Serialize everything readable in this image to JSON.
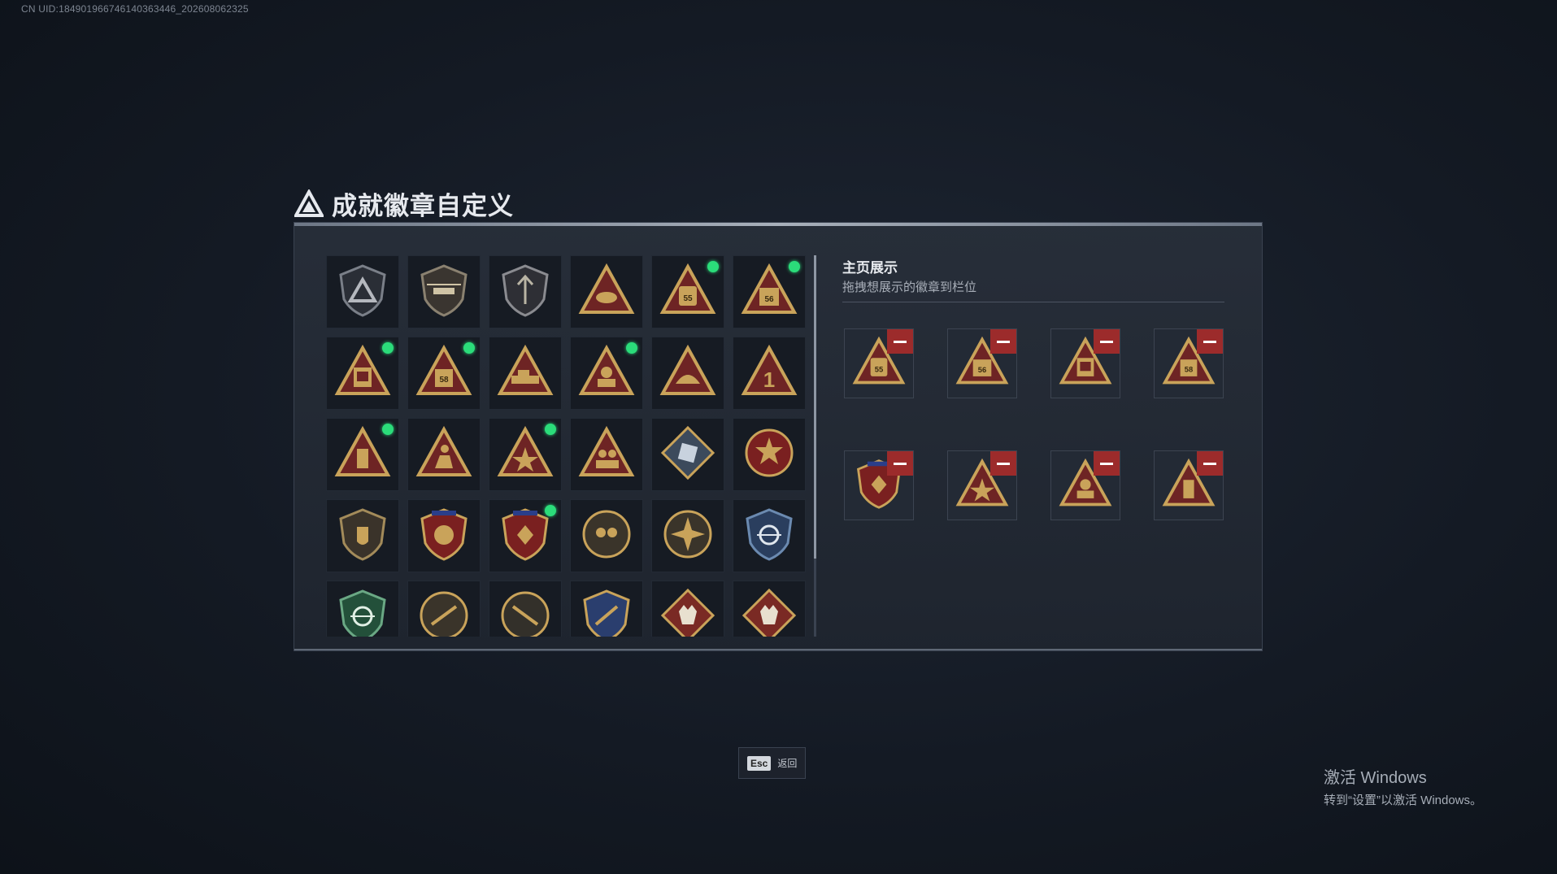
{
  "uid_text": "CN UID:18490196674614036​3446_202608062325",
  "title": "成就徽章自定义",
  "showcase": {
    "title": "主页展示",
    "subtitle": "拖拽想展示的徽章到栏位"
  },
  "esc": {
    "key": "Esc",
    "label": "返回"
  },
  "windows": {
    "title": "激活 Windows",
    "subtitle": "转到“设置”以激活 Windows。"
  },
  "colors": {
    "gold": "#c9a35a",
    "maroon": "#6e2424",
    "new_dot": "#2bdc7a",
    "remove_red": "#9c2b2b"
  },
  "badges": [
    {
      "icon": "shield-triangle-icon",
      "new": false
    },
    {
      "icon": "helicopter-shield-icon",
      "new": false
    },
    {
      "icon": "arrow-shield-icon",
      "new": false
    },
    {
      "icon": "tri-eye-icon",
      "new": false
    },
    {
      "icon": "tri-55-icon",
      "new": true
    },
    {
      "icon": "tri-56-icon",
      "new": true
    },
    {
      "icon": "tri-box-icon",
      "new": true
    },
    {
      "icon": "tri-58-icon",
      "new": true
    },
    {
      "icon": "tri-vehicle-icon",
      "new": false
    },
    {
      "icon": "tri-soldier-icon",
      "new": true
    },
    {
      "icon": "tri-helmet-icon",
      "new": false
    },
    {
      "icon": "tri-1-icon",
      "new": false
    },
    {
      "icon": "tri-bottle-icon",
      "new": true
    },
    {
      "icon": "tri-runner-icon",
      "new": false
    },
    {
      "icon": "tri-star-icon",
      "new": true
    },
    {
      "icon": "tri-squad-icon",
      "new": false
    },
    {
      "icon": "diamond-crate-icon",
      "new": false
    },
    {
      "icon": "round-skull-star-icon",
      "new": false
    },
    {
      "icon": "shield-emblem-icon",
      "new": false
    },
    {
      "icon": "star-shield-a-icon",
      "new": false
    },
    {
      "icon": "star-shield-b-icon",
      "new": true
    },
    {
      "icon": "round-mask-icon",
      "new": false
    },
    {
      "icon": "round-burst-icon",
      "new": false
    },
    {
      "icon": "blue-crosshair-shield-icon",
      "new": false
    },
    {
      "icon": "green-crosshair-shield-icon",
      "new": false
    },
    {
      "icon": "rifle-shield-a-icon",
      "new": false
    },
    {
      "icon": "rifle-shield-b-icon",
      "new": false
    },
    {
      "icon": "blue-gold-shield-icon",
      "new": false
    },
    {
      "icon": "wolf-diamond-a-icon",
      "new": false
    },
    {
      "icon": "wolf-diamond-b-icon",
      "new": false
    }
  ],
  "slots": [
    {
      "icon": "tri-55-icon"
    },
    {
      "icon": "tri-56-icon"
    },
    {
      "icon": "tri-box-icon"
    },
    {
      "icon": "tri-58-icon"
    },
    {
      "icon": "star-shield-b-icon"
    },
    {
      "icon": "tri-star-icon"
    },
    {
      "icon": "tri-soldier-icon"
    },
    {
      "icon": "tri-bottle-icon"
    }
  ]
}
